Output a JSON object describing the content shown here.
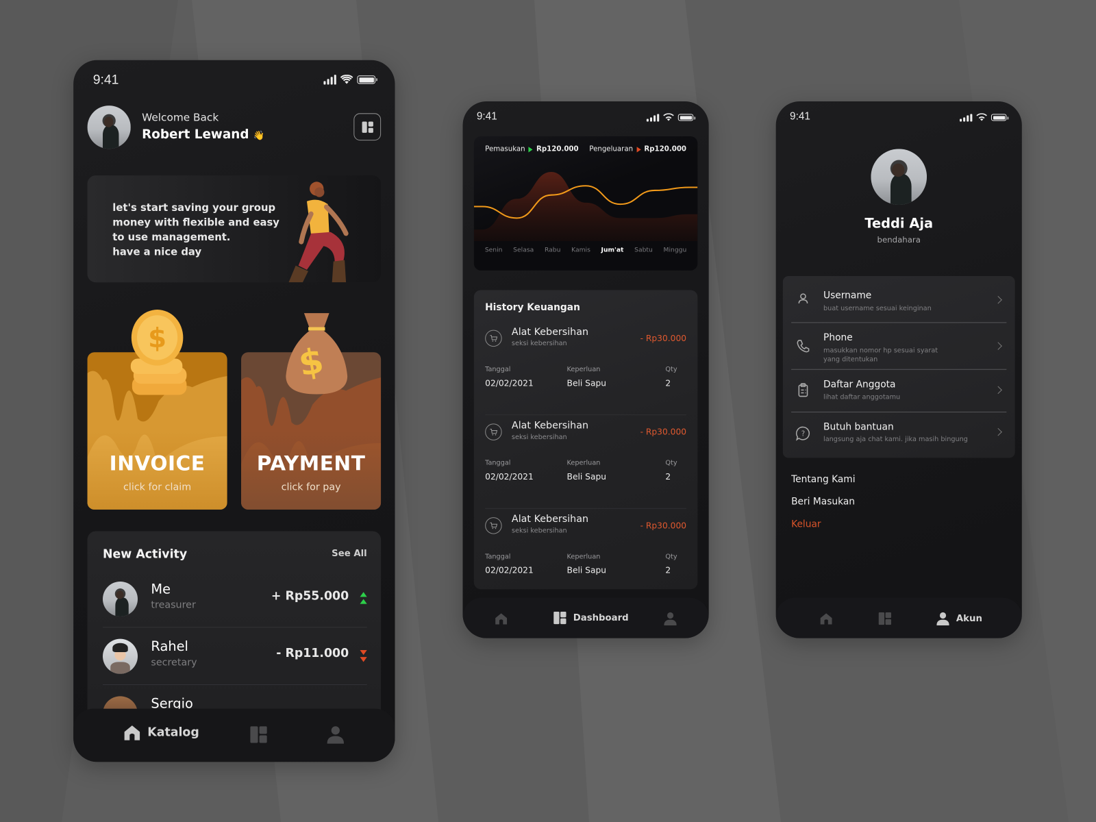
{
  "status_bar": {
    "time": "9:41"
  },
  "home_screen": {
    "greeting": "Welcome Back",
    "user_name": "Robert Lewand",
    "wave_emoji": "👋",
    "banner_text": [
      "let's start saving your group",
      "money with flexible and easy",
      "to use management.",
      "have a nice day"
    ],
    "cards": [
      {
        "title": "INVOICE",
        "subtitle": "click for claim",
        "color": "#b97612",
        "icon": "coin-stack-icon"
      },
      {
        "title": "PAYMENT",
        "subtitle": "click for pay",
        "color": "#6b4834",
        "icon": "money-bag-icon"
      }
    ],
    "activity": {
      "title": "New Activity",
      "see_all": "See All",
      "items": [
        {
          "name": "Me",
          "role": "treasurer",
          "amount": "+ Rp55.000",
          "trend": "up",
          "trend_color": "#2dcf4a"
        },
        {
          "name": "Rahel",
          "role": "secretary",
          "amount": "- Rp11.000",
          "trend": "down",
          "trend_color": "#e04a24"
        },
        {
          "name": "Sergio",
          "role": "",
          "amount": "",
          "trend": ""
        }
      ]
    },
    "nav": {
      "active_label": "Katalog"
    }
  },
  "dashboard_screen": {
    "legend": {
      "income_label": "Pemasukan",
      "income_value": "Rp120.000",
      "expense_label": "Pengeluaran",
      "expense_value": "Rp120.000"
    },
    "chart_data": {
      "type": "area",
      "categories": [
        "Senin",
        "Selasa",
        "Rabu",
        "Kamis",
        "Jum'at",
        "Sabtu",
        "Minggu"
      ],
      "active_category": "Jum'at",
      "series": [
        {
          "name": "Pemasukan (line)",
          "color": "#f29a1a",
          "values": [
            0.45,
            0.3,
            0.6,
            0.72,
            0.48,
            0.66,
            0.7
          ]
        },
        {
          "name": "Pengeluaran (area)",
          "color": "#4a1d14",
          "values": [
            0.15,
            0.55,
            0.9,
            0.5,
            0.3,
            0.3,
            0.35
          ]
        }
      ],
      "title": "",
      "xlabel": "",
      "ylabel": ""
    },
    "history": {
      "title": "History Keuangan",
      "col_labels": {
        "date": "Tanggal",
        "purpose": "Keperluan",
        "qty": "Qty"
      },
      "items": [
        {
          "name": "Alat Kebersihan",
          "sub": "seksi kebersihan",
          "amount": "- Rp30.000",
          "date": "02/02/2021",
          "purpose": "Beli Sapu",
          "qty": "2"
        },
        {
          "name": "Alat Kebersihan",
          "sub": "seksi kebersihan",
          "amount": "- Rp30.000",
          "date": "02/02/2021",
          "purpose": "Beli Sapu",
          "qty": "2"
        },
        {
          "name": "Alat Kebersihan",
          "sub": "seksi kebersihan",
          "amount": "- Rp30.000",
          "date": "02/02/2021",
          "purpose": "Beli Sapu",
          "qty": "2"
        }
      ]
    },
    "nav": {
      "active_label": "Dashboard"
    }
  },
  "account_screen": {
    "name": "Teddi Aja",
    "role": "bendahara",
    "settings": [
      {
        "title": "Username",
        "sub": "buat username sesuai keinginan",
        "icon": "user-icon"
      },
      {
        "title": "Phone",
        "sub": "masukkan nomor  hp sesuai syarat yang ditentukan",
        "icon": "phone-icon"
      },
      {
        "title": "Daftar Anggota",
        "sub": "lihat daftar anggotamu",
        "icon": "clipboard-icon"
      },
      {
        "title": "Butuh bantuan",
        "sub": "langsung aja chat kami. jika masih bingung",
        "icon": "help-chat-icon"
      }
    ],
    "links": {
      "about": "Tentang Kami",
      "feedback": "Beri Masukan",
      "logout": "Keluar"
    },
    "logout_color": "#d9542a",
    "nav": {
      "active_label": "Akun"
    }
  }
}
